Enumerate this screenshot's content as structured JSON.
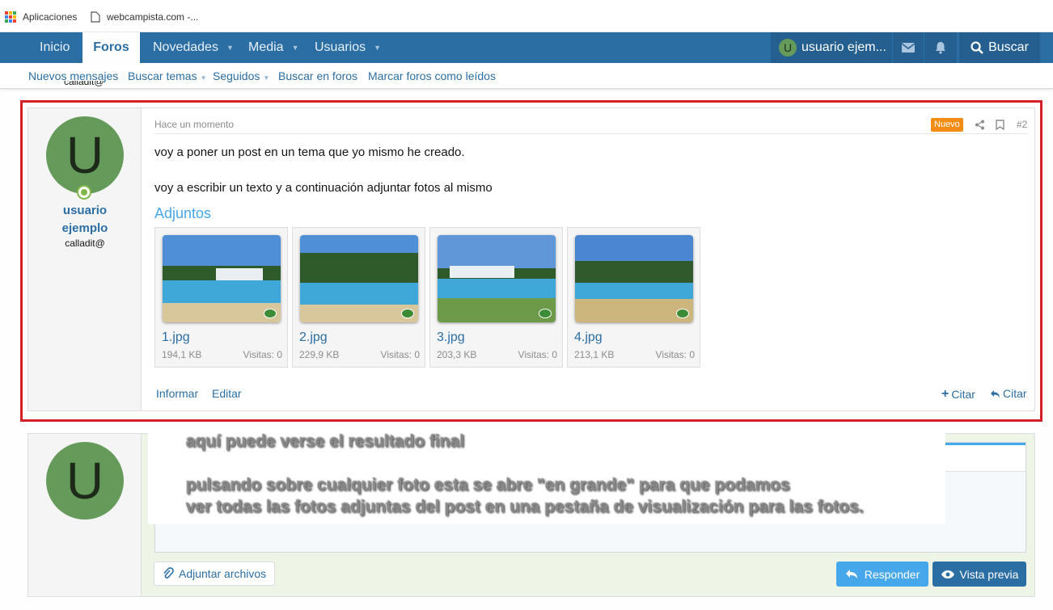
{
  "bookmarks": {
    "apps_label": "Aplicaciones",
    "site_label": "webcampista.com -..."
  },
  "nav": {
    "tabs": [
      {
        "label": "Inicio"
      },
      {
        "label": "Foros"
      },
      {
        "label": "Novedades"
      },
      {
        "label": "Media"
      },
      {
        "label": "Usuarios"
      }
    ],
    "user_initial": "U",
    "user_label": "usuario ejem...",
    "search_label": "Buscar"
  },
  "subnav": {
    "items": [
      {
        "label": "Nuevos mensajes"
      },
      {
        "label": "Buscar temas"
      },
      {
        "label": "Seguidos"
      },
      {
        "label": "Buscar en foros"
      },
      {
        "label": "Marcar foros como leídos"
      }
    ],
    "cut_text": "calladit@"
  },
  "post": {
    "avatar_initial": "U",
    "username_line1": "usuario",
    "username_line2": "ejemplo",
    "user_title": "calladit@",
    "timestamp": "Hace un momento",
    "badge": "Nuevo",
    "number": "#2",
    "text_line1": "voy a poner un post en un tema que yo mismo he creado.",
    "text_line2": "voy a escribir un texto y a continuación adjuntar fotos al mismo",
    "attachments_title": "Adjuntos",
    "attachments": [
      {
        "name": "1.jpg",
        "size": "194,1 KB",
        "views": "Visitas: 0"
      },
      {
        "name": "2.jpg",
        "size": "229,9 KB",
        "views": "Visitas: 0"
      },
      {
        "name": "3.jpg",
        "size": "203,3 KB",
        "views": "Visitas: 0"
      },
      {
        "name": "4.jpg",
        "size": "213,1 KB",
        "views": "Visitas: 0"
      }
    ],
    "actions": {
      "report": "Informar",
      "edit": "Editar",
      "multiquote": "Citar",
      "quote": "Citar"
    }
  },
  "reply": {
    "avatar_initial": "U",
    "attach_label": "Adjuntar archivos",
    "reply_label": "Responder",
    "preview_label": "Vista previa"
  },
  "overlay": {
    "line1": "aquí puede verse el resultado final",
    "line2": "pulsando sobre cualquier foto esta se  abre \"en grande\" para que podamos",
    "line3": "ver todas las fotos adjuntas del post en una pestaña de visualización para las fotos."
  },
  "colors": {
    "nav": "#2b6ea3",
    "highlight": "#d62027",
    "badge": "#f28c12",
    "avatar": "#659a5b"
  }
}
